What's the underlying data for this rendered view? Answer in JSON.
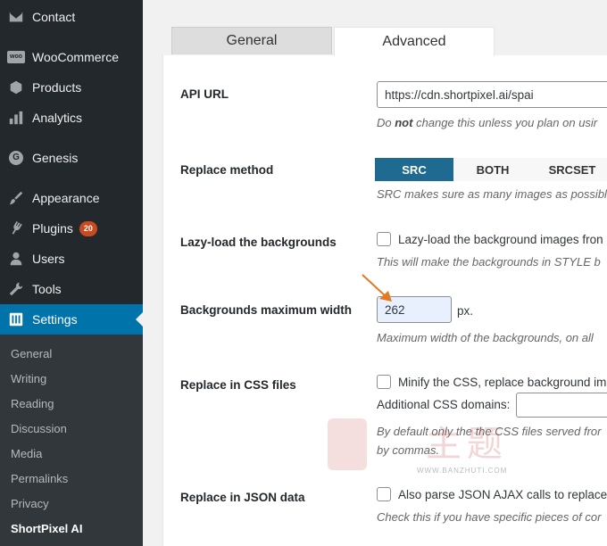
{
  "sidebar": {
    "items": [
      {
        "label": "Contact",
        "icon": "envelope-icon"
      },
      {
        "label": "WooCommerce",
        "icon": "woo-icon"
      },
      {
        "label": "Products",
        "icon": "box-icon"
      },
      {
        "label": "Analytics",
        "icon": "bar-chart-icon"
      },
      {
        "label": "Genesis",
        "icon": "genesis-icon"
      },
      {
        "label": "Appearance",
        "icon": "brush-icon"
      },
      {
        "label": "Plugins",
        "icon": "plug-icon",
        "badge": "20"
      },
      {
        "label": "Users",
        "icon": "user-icon"
      },
      {
        "label": "Tools",
        "icon": "wrench-icon"
      },
      {
        "label": "Settings",
        "icon": "settings-icon"
      }
    ],
    "woo_icon_text": "woo",
    "genesis_icon_text": "G",
    "submenu": [
      "General",
      "Writing",
      "Reading",
      "Discussion",
      "Media",
      "Permalinks",
      "Privacy",
      "ShortPixel AI"
    ]
  },
  "tabs": {
    "general": "General",
    "advanced": "Advanced"
  },
  "settings": {
    "api_url": {
      "label": "API URL",
      "value": "https://cdn.shortpixel.ai/spai",
      "desc_pre": "Do ",
      "desc_bold": "not",
      "desc_post": " change this unless you plan on usir"
    },
    "replace_method": {
      "label": "Replace method",
      "options": [
        "SRC",
        "BOTH",
        "SRCSET"
      ],
      "desc": "SRC makes sure as many images as possibl"
    },
    "lazy_load": {
      "label": "Lazy-load the backgrounds",
      "checkbox_label": "Lazy-load the background images fron",
      "desc": "This will make the backgrounds in STYLE b"
    },
    "bg_max_width": {
      "label": "Backgrounds maximum width",
      "value": "262",
      "unit": "px.",
      "desc": "Maximum width of the backgrounds, on all"
    },
    "replace_css": {
      "label": "Replace in CSS files",
      "checkbox_label": "Minify the CSS, replace background im",
      "domains_label": "Additional CSS domains:",
      "desc1": "By default only the the CSS files served fror",
      "desc2": "by commas."
    },
    "replace_json": {
      "label": "Replace in JSON data",
      "checkbox_label": "Also parse JSON AJAX calls to replace",
      "desc": "Check this if you have specific pieces of cor"
    }
  },
  "watermark": {
    "cjk": "主题",
    "site": "WWW.BANZHUTI.COM"
  },
  "colors": {
    "accent": "#0073aa",
    "segment_on": "#1e6a91",
    "arrow": "#e07b22",
    "badge": "#ca4a1f"
  }
}
